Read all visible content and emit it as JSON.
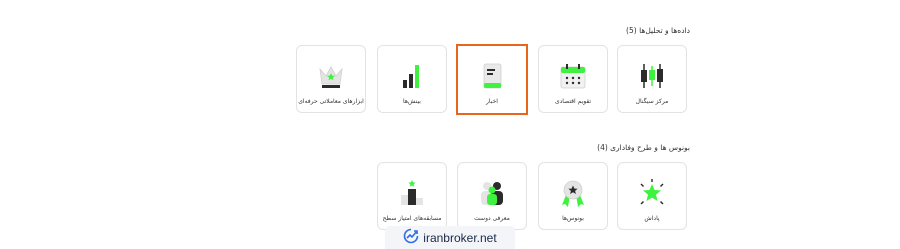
{
  "colors": {
    "accent_green": "#3ff23f",
    "highlight_border": "#e8651c",
    "icon_dark": "#2b2b2b"
  },
  "section1": {
    "title": "داده‌ها و تحلیل‌ها (5)",
    "cards": [
      {
        "label": "مرکز سیگنال",
        "icon": "candlestick-icon"
      },
      {
        "label": "تقویم اقتصادی",
        "icon": "calendar-icon"
      },
      {
        "label": "اخبار",
        "icon": "news-icon",
        "selected": true
      },
      {
        "label": "بینش‌ها",
        "icon": "bar-chart-icon"
      },
      {
        "label": "ابزارهای معاملاتی حرفه‌ای",
        "icon": "crown-icon"
      }
    ]
  },
  "section2": {
    "title": "بونوس ها و طرح وفاداری (4)",
    "cards": [
      {
        "label": "پاداش",
        "icon": "star-burst-icon"
      },
      {
        "label": "بونوس‌ها",
        "icon": "medal-icon"
      },
      {
        "label": "معرفی دوست",
        "icon": "people-icon"
      },
      {
        "label": "مسابقه‌های امتیاز سطح",
        "icon": "podium-icon"
      }
    ]
  },
  "watermark": {
    "text": "iranbroker.net"
  }
}
